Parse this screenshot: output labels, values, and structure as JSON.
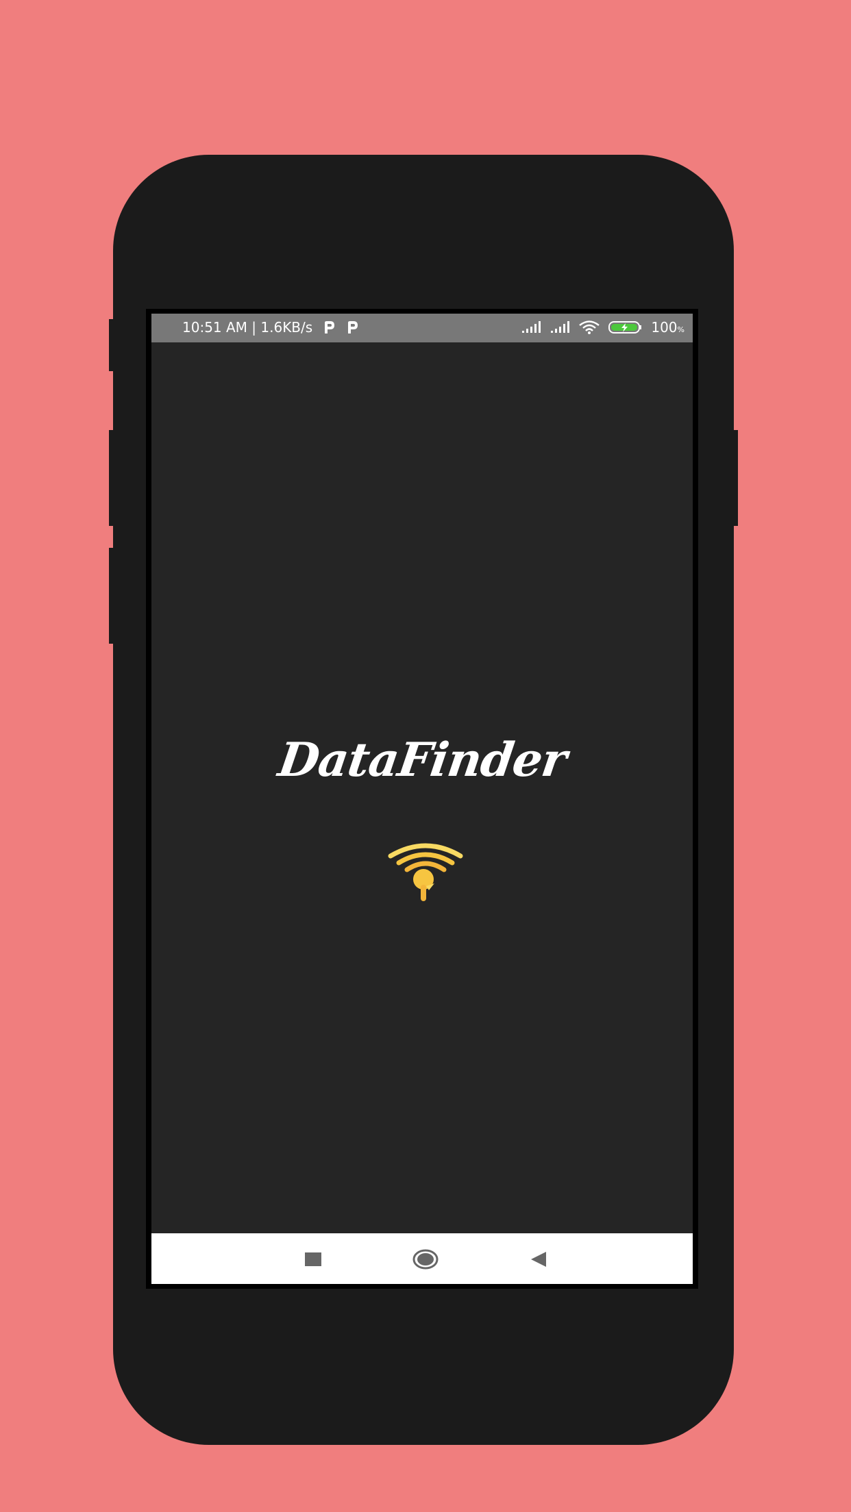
{
  "status_bar": {
    "time_and_speed": "10:51 AM | 1.6KB/s",
    "battery_percent": "100",
    "battery_unit": "%",
    "icons": [
      "p-app-icon",
      "p-app-icon",
      "signal-icon",
      "signal-icon",
      "wifi-icon",
      "battery-charging-icon"
    ]
  },
  "app": {
    "name": "DataFinder",
    "logo_icon": "wifi-lightbulb-icon"
  },
  "nav_bar": {
    "buttons": [
      "recents-button",
      "home-button",
      "back-button"
    ]
  },
  "colors": {
    "background": "#f07e7e",
    "phone_body": "#1b1b1b",
    "screen_bg": "#252525",
    "statusbar_bg": "#787878",
    "logo_yellow": "#f6c541",
    "battery_green": "#4cc83c"
  }
}
